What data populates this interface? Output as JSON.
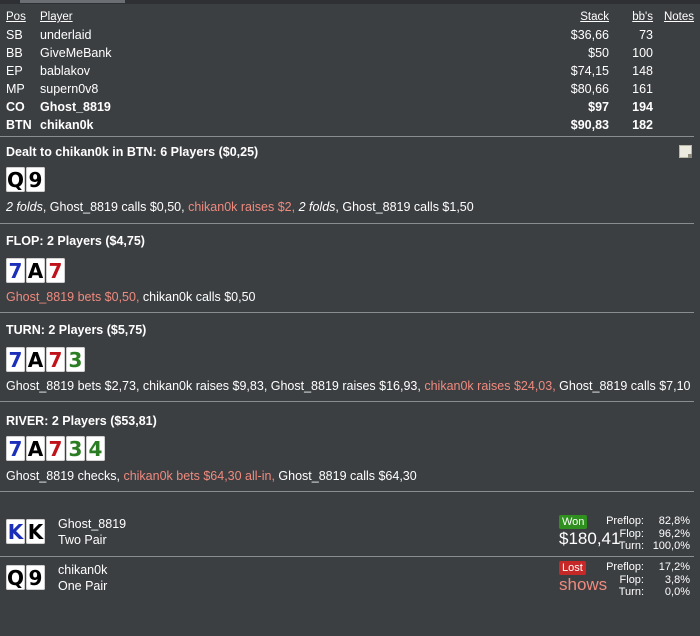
{
  "table": {
    "headers": {
      "pos": "Pos",
      "player": "Player",
      "stack": "Stack",
      "bb": "bb's",
      "notes": "Notes"
    },
    "rows": [
      {
        "pos": "SB",
        "player": "underlaid",
        "stack": "$36,66",
        "bb": "73",
        "bold": false
      },
      {
        "pos": "BB",
        "player": "GiveMeBank",
        "stack": "$50",
        "bb": "100",
        "bold": false
      },
      {
        "pos": "EP",
        "player": "bablakov",
        "stack": "$74,15",
        "bb": "148",
        "bold": false
      },
      {
        "pos": "MP",
        "player": "supern0v8",
        "stack": "$80,66",
        "bb": "161",
        "bold": false
      },
      {
        "pos": "CO",
        "player": "Ghost_8819",
        "stack": "$97",
        "bb": "194",
        "bold": true
      },
      {
        "pos": "BTN",
        "player": "chikan0k",
        "stack": "$90,83",
        "bb": "182",
        "bold": true
      }
    ]
  },
  "streets": [
    {
      "title": "Dealt to chikan0k in BTN: 6 Players ($0,25)",
      "cards": [
        {
          "rank": "Q",
          "suit": "s"
        },
        {
          "rank": "9",
          "suit": "s"
        }
      ],
      "actions": [
        {
          "text": "2 folds",
          "style": "it"
        },
        {
          "text": ", Ghost_8819 calls $0,50, ",
          "style": ""
        },
        {
          "text": "chikan0k raises $2, ",
          "style": "hl"
        },
        {
          "text": "2 folds",
          "style": "it"
        },
        {
          "text": ", Ghost_8819 calls $1,50",
          "style": ""
        }
      ]
    },
    {
      "title": "FLOP: 2 Players ($4,75)",
      "cards": [
        {
          "rank": "7",
          "suit": "d"
        },
        {
          "rank": "A",
          "suit": "s"
        },
        {
          "rank": "7",
          "suit": "h"
        }
      ],
      "actions": [
        {
          "text": "Ghost_8819 bets $0,50, ",
          "style": "hl"
        },
        {
          "text": "chikan0k calls $0,50",
          "style": ""
        }
      ]
    },
    {
      "title": "TURN: 2 Players ($5,75)",
      "cards": [
        {
          "rank": "7",
          "suit": "d"
        },
        {
          "rank": "A",
          "suit": "s"
        },
        {
          "rank": "7",
          "suit": "h"
        },
        {
          "rank": "3",
          "suit": "c"
        }
      ],
      "actions": [
        {
          "text": "Ghost_8819 bets $2,73, chikan0k raises $9,83, Ghost_8819 raises $16,93, ",
          "style": ""
        },
        {
          "text": "chikan0k raises $24,03, ",
          "style": "hl"
        },
        {
          "text": "Ghost_8819 calls $7,10",
          "style": ""
        }
      ]
    },
    {
      "title": "RIVER: 2 Players ($53,81)",
      "cards": [
        {
          "rank": "7",
          "suit": "d"
        },
        {
          "rank": "A",
          "suit": "s"
        },
        {
          "rank": "7",
          "suit": "h"
        },
        {
          "rank": "3",
          "suit": "c"
        },
        {
          "rank": "4",
          "suit": "c"
        }
      ],
      "actions": [
        {
          "text": "Ghost_8819 checks, ",
          "style": ""
        },
        {
          "text": "chikan0k bets $64,30 all-in, ",
          "style": "hl"
        },
        {
          "text": "Ghost_8819 calls $64,30",
          "style": ""
        }
      ]
    }
  ],
  "results": [
    {
      "player": "Ghost_8819",
      "hand": "Two Pair",
      "cards": [
        {
          "rank": "K",
          "suit": "d"
        },
        {
          "rank": "K",
          "suit": "s"
        }
      ],
      "badge": "Won",
      "badge_type": "won",
      "amount": "$180,41",
      "amount_type": "",
      "stats": [
        {
          "label": "Preflop:",
          "value": "82,8%"
        },
        {
          "label": "Flop:",
          "value": "96,2%"
        },
        {
          "label": "Turn:",
          "value": "100,0%"
        }
      ]
    },
    {
      "player": "chikan0k",
      "hand": "One Pair",
      "cards": [
        {
          "rank": "Q",
          "suit": "s"
        },
        {
          "rank": "9",
          "suit": "s"
        }
      ],
      "badge": "Lost",
      "badge_type": "lost",
      "amount": "shows",
      "amount_type": "shows",
      "stats": [
        {
          "label": "Preflop:",
          "value": "17,2%"
        },
        {
          "label": "Flop:",
          "value": "3,8%"
        },
        {
          "label": "Turn:",
          "value": "0,0%"
        }
      ]
    }
  ],
  "icons": {
    "note": "note-icon"
  },
  "colors": {
    "background": "#3c3f42",
    "highlight": "#ef8a7e",
    "won": "#2f8f1f",
    "lost": "#c62828"
  }
}
